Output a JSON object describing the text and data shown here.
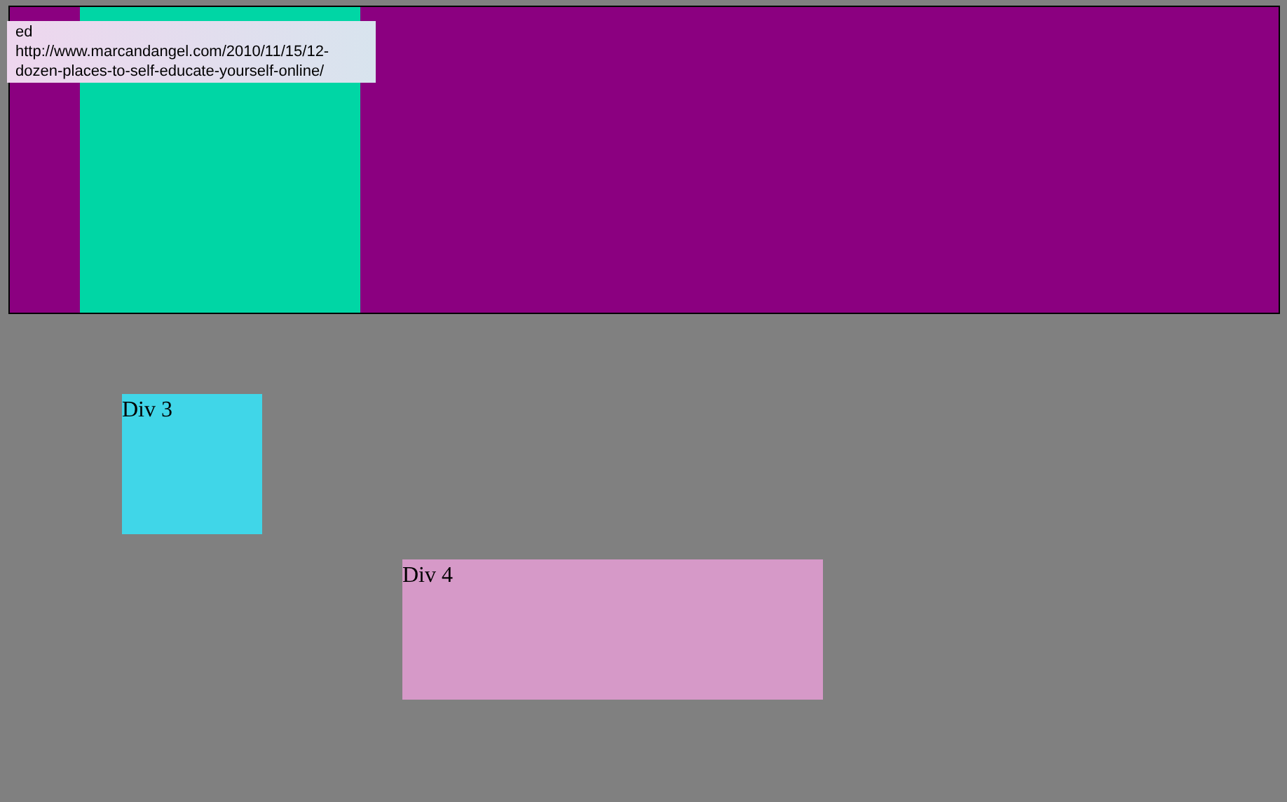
{
  "tooltip": {
    "lines": [
      "ed",
      "http://www.marcandangel.com/2010/11/15/12-",
      "dozen-places-to-self-educate-yourself-online/"
    ]
  },
  "div3": {
    "label": "Div 3"
  },
  "div4": {
    "label": "Div 4"
  }
}
